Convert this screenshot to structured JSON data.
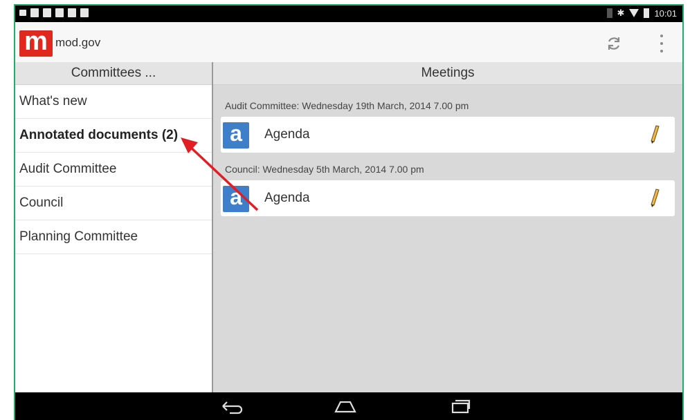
{
  "status_bar": {
    "time": "10:01"
  },
  "app": {
    "brand_letter": "m",
    "title": "mod.gov"
  },
  "left_pane": {
    "header": "Committees ...",
    "items": [
      {
        "label": "What's new"
      },
      {
        "label": "Annotated documents (2)"
      },
      {
        "label": "Audit Committee"
      },
      {
        "label": "Council"
      },
      {
        "label": "Planning Committee"
      }
    ]
  },
  "right_pane": {
    "header": "Meetings",
    "groups": [
      {
        "title": "Audit Committee: Wednesday 19th March, 2014 7.00 pm",
        "doc_icon_letter": "a",
        "doc_label": "Agenda"
      },
      {
        "title": "Council: Wednesday 5th March, 2014 7.00 pm",
        "doc_icon_letter": "a",
        "doc_label": "Agenda"
      }
    ]
  },
  "icons": {
    "refresh": "refresh-icon",
    "overflow": "overflow-menu-icon",
    "edit": "pencil-icon",
    "back": "back-icon",
    "home": "home-icon",
    "recents": "recent-apps-icon"
  },
  "colors": {
    "brand_red": "#e0281f",
    "doc_blue": "#3f7fc9",
    "annotation_arrow": "#e01e24",
    "frame_green": "#1fae6a"
  }
}
